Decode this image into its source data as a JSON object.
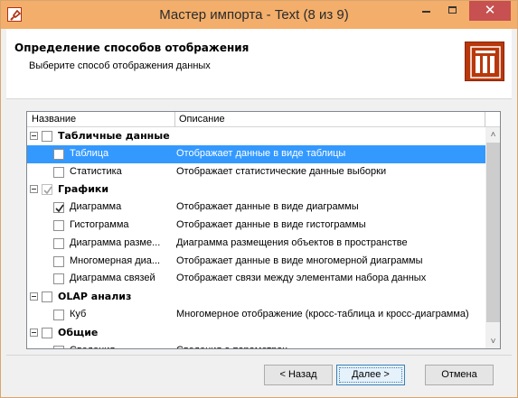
{
  "window": {
    "title": "Мастер импорта - Text (8 из 9)",
    "close_glyph": "✕",
    "colors": {
      "titlebar": "#f3ae6b",
      "close": "#c75050",
      "accent_icon": "#b8380c",
      "selection": "#3399ff"
    }
  },
  "header": {
    "title": "Определение способов отображения",
    "subtitle": "Выберите способ отображения данных"
  },
  "list": {
    "columns": [
      "Название",
      "Описание"
    ],
    "rows": [
      {
        "type": "group",
        "name": "Табличные данные",
        "checked": false,
        "disabled": false
      },
      {
        "type": "item",
        "name": "Таблица",
        "description": "Отображает данные в виде таблицы",
        "checked": false,
        "selected": true
      },
      {
        "type": "item",
        "name": "Статистика",
        "description": "Отображает статистические данные выборки",
        "checked": false,
        "selected": false
      },
      {
        "type": "group",
        "name": "Графики",
        "checked": true,
        "disabled": true
      },
      {
        "type": "item",
        "name": "Диаграмма",
        "description": "Отображает данные в виде диаграммы",
        "checked": true,
        "selected": false
      },
      {
        "type": "item",
        "name": "Гистограмма",
        "description": "Отображает данные в виде гистограммы",
        "checked": false,
        "selected": false
      },
      {
        "type": "item",
        "name": "Диаграмма разме...",
        "description": "Диаграмма размещения объектов в пространстве",
        "checked": false,
        "selected": false
      },
      {
        "type": "item",
        "name": "Многомерная диа...",
        "description": "Отображает данные в виде многомерной диаграммы",
        "checked": false,
        "selected": false
      },
      {
        "type": "item",
        "name": "Диаграмма связей",
        "description": "Отображает связи между элементами набора данных",
        "checked": false,
        "selected": false
      },
      {
        "type": "group",
        "name": "OLAP анализ",
        "checked": false,
        "disabled": false
      },
      {
        "type": "item",
        "name": "Куб",
        "description": "Многомерное отображение (кросс-таблица и кросс-диаграмма)",
        "checked": false,
        "selected": false
      },
      {
        "type": "group",
        "name": "Общие",
        "checked": false,
        "disabled": false
      },
      {
        "type": "item",
        "name": "Сведения",
        "description": "Сведения о параметрах",
        "checked": false,
        "selected": false
      }
    ]
  },
  "buttons": {
    "back": "< Назад",
    "next": "Далее >",
    "cancel": "Отмена"
  }
}
